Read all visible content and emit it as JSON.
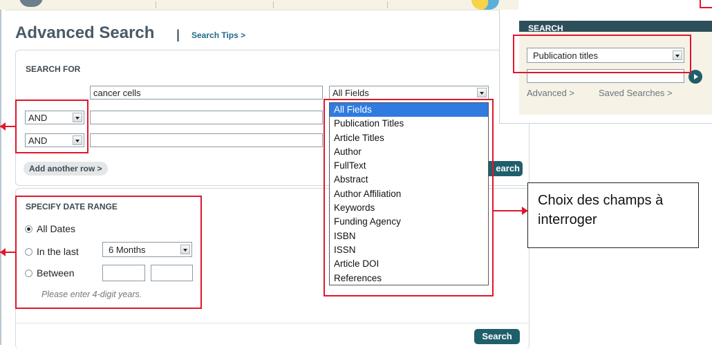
{
  "page": {
    "title": "Advanced Search",
    "title_separator": "|",
    "search_tips": "Search Tips >"
  },
  "search_for": {
    "heading": "SEARCH FOR",
    "rows": [
      {
        "operator": "",
        "term": "cancer cells",
        "field": "All Fields"
      },
      {
        "operator": "AND",
        "term": "",
        "field": ""
      },
      {
        "operator": "AND",
        "term": "",
        "field": ""
      }
    ],
    "add_row_label": "Add another row >",
    "search_button_partial": "earch"
  },
  "field_dropdown": {
    "selected": "All Fields",
    "options": [
      "All Fields",
      "Publication Titles",
      "Article Titles",
      "Author",
      "FullText",
      "Abstract",
      "Author Affiliation",
      "Keywords",
      "Funding Agency",
      "ISBN",
      "ISSN",
      "Article DOI",
      "References"
    ]
  },
  "date_range": {
    "heading": "SPECIFY DATE RANGE",
    "options": [
      "All Dates",
      "In the last",
      "Between"
    ],
    "selected_option": "All Dates",
    "last_period": "6 Months",
    "hint": "Please enter 4-digit years."
  },
  "bottom_search_button": "Search",
  "quick_search_widget": {
    "heading": "SEARCH",
    "scope": "Publication titles",
    "links": [
      "Advanced >",
      "Saved Searches >"
    ]
  },
  "annotation": {
    "callout_text": "Choix des champs à interroger"
  },
  "colors": {
    "annotation_red": "#e0162b",
    "button_dark": "#1f5f6b",
    "link_blue": "#1f6a8a",
    "dropdown_highlight": "#2f7be0"
  }
}
